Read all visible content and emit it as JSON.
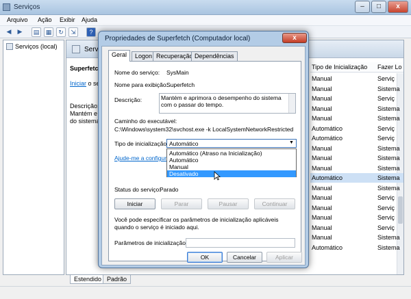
{
  "main_window": {
    "title": "Serviços",
    "menu": [
      "Arquivo",
      "Ação",
      "Exibir",
      "Ajuda"
    ],
    "left_tree_item": "Serviços (local)",
    "center_header": "Servi",
    "detail_title": "Superfetch",
    "detail_link": "Iniciar",
    "detail_link_suffix": " o se",
    "detail_desc_label": "Descrição:",
    "detail_desc_line1": "Mantém e a",
    "detail_desc_line2": "do sistema",
    "columns": [
      "Tipo de Inicialização",
      "Fazer Lo"
    ],
    "rows": [
      {
        "start": "Manual",
        "logon": "Serviç"
      },
      {
        "start": "Manual",
        "logon": "Sistema"
      },
      {
        "start": "Manual",
        "logon": "Serviç"
      },
      {
        "start": "Manual",
        "logon": "Sistema"
      },
      {
        "start": "Manual",
        "logon": "Sistema"
      },
      {
        "start": "Automático",
        "logon": "Serviç"
      },
      {
        "start": "Automático",
        "logon": "Serviç"
      },
      {
        "start": "Manual",
        "logon": "Sistema"
      },
      {
        "start": "Manual",
        "logon": "Sistema"
      },
      {
        "start": "Manual",
        "logon": "Sistema"
      },
      {
        "start": "Automático",
        "logon": "Sistema"
      },
      {
        "start": "Manual",
        "logon": "Sistema"
      },
      {
        "start": "Manual",
        "logon": "Serviç"
      },
      {
        "start": "Manual",
        "logon": "Serviç"
      },
      {
        "start": "Manual",
        "logon": "Serviç"
      },
      {
        "start": "Manual",
        "logon": "Serviç"
      },
      {
        "start": "Manual",
        "logon": "Sistema"
      },
      {
        "start": "Automático",
        "logon": "Sistema"
      }
    ],
    "selected_row": 10,
    "bottom_tabs": [
      "Estendido",
      "Padrão"
    ]
  },
  "dialog": {
    "title": "Propriedades de Superfetch (Computador local)",
    "close_label": "x",
    "tabs": [
      "Geral",
      "Logon",
      "Recuperação",
      "Dependências"
    ],
    "service_name_label": "Nome do serviço:",
    "service_name": "SysMain",
    "display_name_label": "Nome para exibição:",
    "display_name": "Superfetch",
    "description_label": "Descrição:",
    "description": "Mantém e aprimora o desempenho do sistema com o passar do tempo.",
    "path_label": "Caminho do executável:",
    "path": "C:\\Windows\\system32\\svchost.exe -k LocalSystemNetworkRestricted",
    "startup_type_label": "Tipo de inicialização:",
    "startup_type_value": "Automático",
    "startup_options": [
      "Automático (Atraso na Inicialização)",
      "Automático",
      "Manual",
      "Desativado"
    ],
    "highlighted_option": 3,
    "help_link": "Ajude-me a configurar",
    "status_label": "Status do serviço:",
    "status_value": "Parado",
    "btn_start": "Iniciar",
    "btn_stop": "Parar",
    "btn_pause": "Pausar",
    "btn_continue": "Continuar",
    "params_note": "Você pode especificar os parâmetros de inicialização aplicáveis quando o serviço é iniciado aqui.",
    "params_label": "Parâmetros de inicialização:",
    "params_value": "",
    "btn_ok": "OK",
    "btn_cancel": "Cancelar",
    "btn_apply": "Aplicar"
  },
  "colors": {
    "selection": "#3399ff",
    "link": "#0066cc"
  }
}
